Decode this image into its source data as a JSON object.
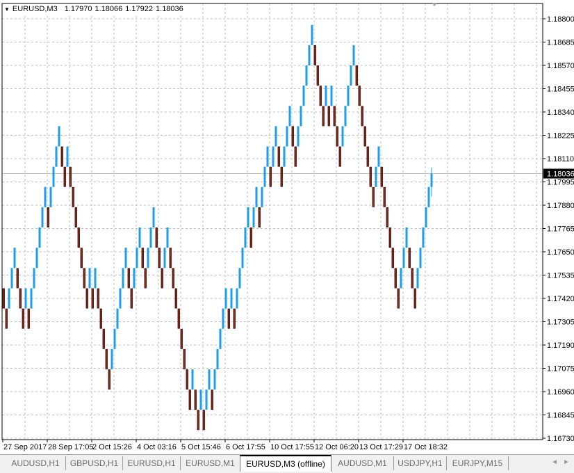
{
  "header": {
    "symbol": "EURUSD,M3",
    "open": "1.17970",
    "high": "1.18066",
    "low": "1.17922",
    "close": "1.18036"
  },
  "colors": {
    "up": "#1e9ee8",
    "down": "#8b2416",
    "down_border": "#3a0a05",
    "grid": "#c0c0c0",
    "close_line": "#c0c0c0",
    "price_tag_bg": "#000000",
    "price_tag_fg": "#ffffff"
  },
  "chart_data": {
    "type": "renko",
    "brick_size": 0.001,
    "base_price": 1.1727,
    "start_level": 2,
    "bricks": [
      "D",
      "D",
      "U",
      "U",
      "U",
      "D",
      "D",
      "D",
      "U",
      "D",
      "U",
      "U",
      "U",
      "U",
      "U",
      "U",
      "D",
      "U",
      "U",
      "U",
      "U",
      "D",
      "D",
      "U",
      "D",
      "D",
      "D",
      "D",
      "D",
      "D",
      "D",
      "U",
      "D",
      "U",
      "D",
      "D",
      "D",
      "D",
      "D",
      "U",
      "U",
      "U",
      "U",
      "U",
      "U",
      "D",
      "D",
      "U",
      "U",
      "U",
      "D",
      "D",
      "U",
      "U",
      "U",
      "D",
      "D",
      "D",
      "U",
      "U",
      "D",
      "D",
      "D",
      "D",
      "D",
      "D",
      "D",
      "D",
      "U",
      "D",
      "D",
      "U",
      "D",
      "U",
      "U",
      "D",
      "U",
      "U",
      "U",
      "U",
      "U",
      "D",
      "U",
      "D",
      "U",
      "U",
      "U",
      "U",
      "U",
      "D",
      "U",
      "U",
      "D",
      "U",
      "U",
      "U",
      "D",
      "U",
      "U",
      "D",
      "D",
      "U",
      "U",
      "U",
      "D",
      "D",
      "U",
      "U",
      "U",
      "U",
      "U",
      "U",
      "D",
      "D",
      "D",
      "D",
      "U",
      "D",
      "U",
      "D",
      "D",
      "D",
      "U",
      "U",
      "U",
      "U",
      "U",
      "D",
      "D",
      "D",
      "D",
      "D",
      "D",
      "D",
      "U",
      "U",
      "D",
      "D",
      "D",
      "D",
      "D",
      "D",
      "D",
      "U",
      "U",
      "U",
      "D",
      "D",
      "D",
      "U",
      "U",
      "U",
      "U",
      "U"
    ],
    "last_bar": {
      "open": 1.1797,
      "high": 1.18066,
      "low": 1.17922,
      "close": 1.18036
    },
    "ylim": [
      1.1673,
      1.188
    ],
    "y_ticks": [
      "1.18800",
      "1.18685",
      "1.18570",
      "1.18455",
      "1.18340",
      "1.18225",
      "1.18110",
      "1.17995",
      "1.17880",
      "1.17765",
      "1.17650",
      "1.17535",
      "1.17420",
      "1.17305",
      "1.17190",
      "1.17075",
      "1.16960",
      "1.16845",
      "1.16730"
    ],
    "current_price_label": "1.18036",
    "x_ticks": [
      "27 Sep 2017",
      "28 Sep 17:05",
      "2 Oct 15:26",
      "4 Oct 03:16",
      "5 Oct 15:46",
      "6 Oct 17:55",
      "10 Oct 17:55",
      "12 Oct 06:20",
      "13 Oct 17:29",
      "17 Oct 18:32"
    ],
    "grid": true
  },
  "tabs": [
    {
      "label": "AUDUSD,H1"
    },
    {
      "label": "GBPUSD,H1"
    },
    {
      "label": "EURUSD,H1"
    },
    {
      "label": "EURUSD,M1"
    },
    {
      "label": "EURUSD,M3 (offline)",
      "active": true
    },
    {
      "label": "AUDUSD,M1"
    },
    {
      "label": "USDJPY,H1"
    },
    {
      "label": "EURJPY,M15"
    }
  ],
  "scroll": {
    "left": "◄",
    "right": "►"
  }
}
